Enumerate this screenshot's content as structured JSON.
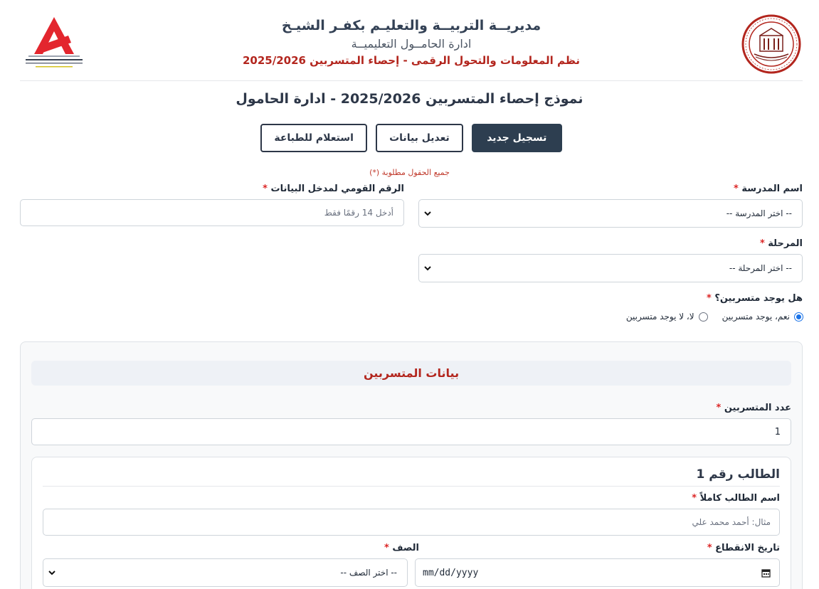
{
  "header": {
    "line1": "مديريــة التربيــة والتعليـم بكفـر الشيـخ",
    "line2": "ادارة الحامــول التعليميــة",
    "line3": "نظم المعلومات والتحول الرقمى - إحصاء المتسربين 2025/2026",
    "left_logo": {
      "name": "info-systems-logo",
      "text_ar": "نظم المعلومات والتحول الرقمى",
      "text_en": "Information Systems and Digital Transformation",
      "text_sub": "مسئولة الادارة الرقمى احمد الشحات",
      "color": "#e3262e"
    },
    "right_logo": {
      "name": "hamoul-education-seal",
      "text_top": "ادارة الحامول التعليمية",
      "color": "#b3261e"
    }
  },
  "form": {
    "title": "نموذج إحصاء المتسربين 2025/2026 - ادارة الحامول",
    "tabs": [
      {
        "label": "تسجيل جديد",
        "active": true
      },
      {
        "label": "تعديل بيانات",
        "active": false
      },
      {
        "label": "استعلام للطباعة",
        "active": false
      }
    ],
    "required_note": "جميع الحقول مطلوبة (*)",
    "required_mark": "*",
    "school": {
      "label": "اسم المدرسة",
      "value": "-- اختر المدرسة --"
    },
    "national_id": {
      "label": "الرقم القومي لمدخل البيانات",
      "placeholder": "أدخل 14 رقمًا فقط"
    },
    "stage": {
      "label": "المرحلة",
      "value": "-- اختر المرحلة --"
    },
    "has_dropouts": {
      "label": "هل يوجد متسربين؟",
      "options": [
        {
          "label": "نعم، يوجد متسربين",
          "checked": true
        },
        {
          "label": "لا، لا يوجد متسربين",
          "checked": false
        }
      ]
    }
  },
  "dropouts": {
    "section_title": "بيانات المتسربين",
    "count_label": "عدد المتسربين",
    "count_value": "1",
    "student": {
      "title": "الطالب رقم 1",
      "name_label": "اسم الطالب كاملاً",
      "name_placeholder": "مثال: أحمد محمد علي",
      "date_label": "تاريخ الانقطاع",
      "date_value": "mm/dd/yyyy",
      "grade_label": "الصف",
      "grade_value": "-- اختر الصف --"
    }
  },
  "colors": {
    "primary": "#2d3e50",
    "required": "#dc2626",
    "accent_red": "#b3261e",
    "radio": "#1a73e8"
  }
}
